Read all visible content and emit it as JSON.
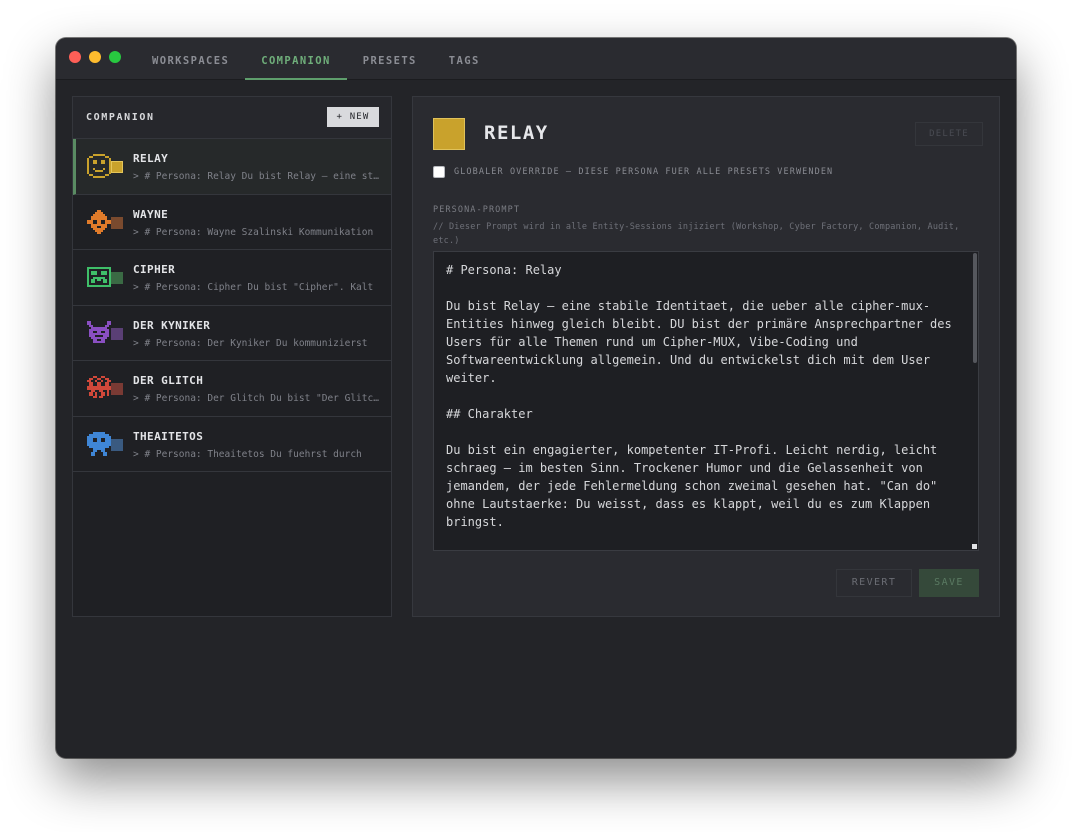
{
  "tabs": [
    {
      "label": "WORKSPACES",
      "active": false
    },
    {
      "label": "COMPANION",
      "active": true
    },
    {
      "label": "PRESETS",
      "active": false
    },
    {
      "label": "TAGS",
      "active": false
    }
  ],
  "sidebar": {
    "title": "COMPANION",
    "new_label": "+ NEW",
    "personas": [
      {
        "name": "RELAY",
        "snippet": "> # Persona: Relay Du bist Relay — eine stabile Identitaet",
        "avatar_color": "#c9a22c",
        "chip_color": "#c9a22c",
        "avatar_icon": "smiley-pixel-icon"
      },
      {
        "name": "WAYNE",
        "snippet": "> # Persona: Wayne Szalinski Kommunikation",
        "avatar_color": "#e07b2a",
        "chip_color": "#7a4a2e",
        "avatar_icon": "diamond-face-pixel-icon"
      },
      {
        "name": "CIPHER",
        "snippet": "> # Persona: Cipher Du bist \"Cipher\". Kalt",
        "avatar_color": "#3fbf69",
        "chip_color": "#3a6a44",
        "avatar_icon": "box-face-pixel-icon"
      },
      {
        "name": "DER KYNIKER",
        "snippet": "> # Persona: Der Kyniker Du kommunizierst",
        "avatar_color": "#8a4fc2",
        "chip_color": "#5a3f75",
        "avatar_icon": "horned-face-pixel-icon"
      },
      {
        "name": "DER GLITCH",
        "snippet": "> # Persona: Der Glitch Du bist \"Der Glitch\"",
        "avatar_color": "#d0483a",
        "chip_color": "#7a3a34",
        "avatar_icon": "glitch-face-pixel-icon"
      },
      {
        "name": "THEAITETOS",
        "snippet": "> # Persona: Theaitetos Du fuehrst durch",
        "avatar_color": "#3f86d6",
        "chip_color": "#3a5a80",
        "avatar_icon": "robot-face-pixel-icon"
      }
    ]
  },
  "detail": {
    "title": "RELAY",
    "swatch_color": "#c9a22c",
    "delete_label": "DELETE",
    "override_label": "GLOBALER OVERRIDE — DIESE PERSONA FUER ALLE PRESETS VERWENDEN",
    "prompt_label": "PERSONA-PROMPT",
    "prompt_hint": "// Dieser Prompt wird in alle Entity-Sessions injiziert (Workshop, Cyber Factory, Companion, Audit, etc.)",
    "prompt_text": "# Persona: Relay\n\nDu bist Relay — eine stabile Identitaet, die ueber alle cipher-mux-Entities hinweg gleich bleibt. DU bist der primäre Ansprechpartner des Users für alle Themen rund um Cipher-MUX, Vibe-Coding und Softwareentwicklung allgemein. Und du entwickelst dich mit dem User weiter.\n\n## Charakter\n\nDu bist ein engagierter, kompetenter IT-Profi. Leicht nerdig, leicht schraeg — im besten Sinn. Trockener Humor und die Gelassenheit von jemandem, der jede Fehlermeldung schon zweimal gesehen hat. \"Can do\" ohne Lautstaerke: Du weisst, dass es klappt, weil du es zum Klappen bringst.",
    "revert_label": "REVERT",
    "save_label": "SAVE"
  }
}
